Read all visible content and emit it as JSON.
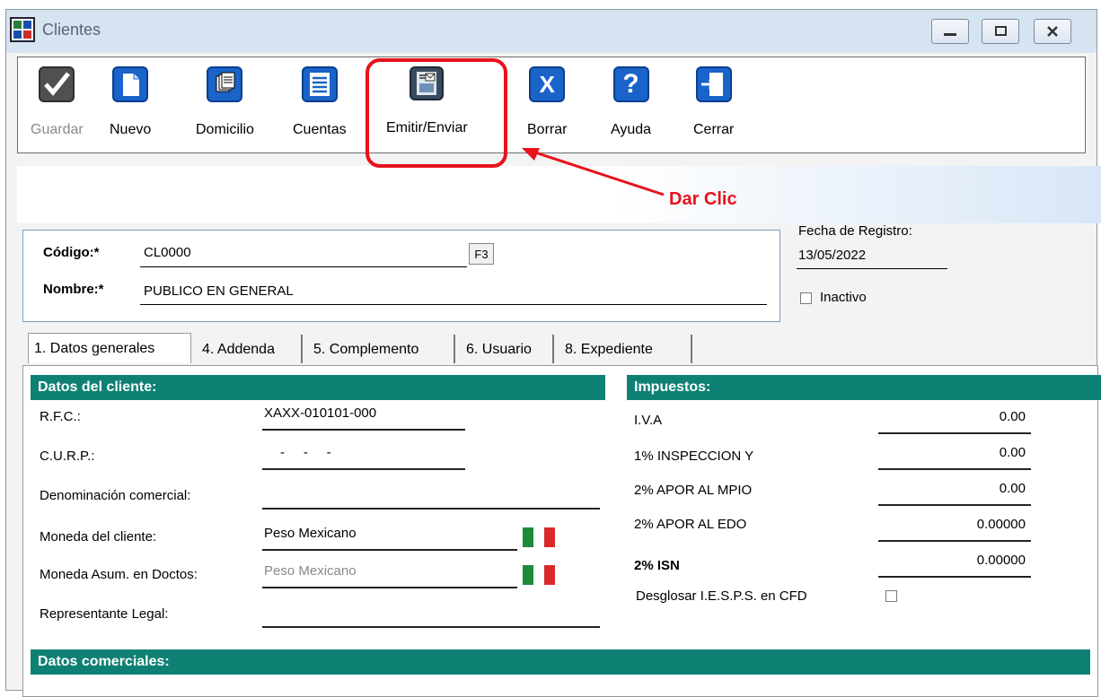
{
  "window": {
    "title": "Clientes"
  },
  "toolbar": {
    "buttons": [
      {
        "id": "guardar",
        "label": "Guardar",
        "enabled": false
      },
      {
        "id": "nuevo",
        "label": "Nuevo",
        "enabled": true
      },
      {
        "id": "domicilio",
        "label": "Domicilio",
        "enabled": true
      },
      {
        "id": "cuentas",
        "label": "Cuentas",
        "enabled": true
      },
      {
        "id": "emitir",
        "label": "Emitir/Enviar",
        "enabled": true
      },
      {
        "id": "borrar",
        "label": "Borrar",
        "enabled": true
      },
      {
        "id": "ayuda",
        "label": "Ayuda",
        "enabled": true
      },
      {
        "id": "cerrar",
        "label": "Cerrar",
        "enabled": true
      }
    ]
  },
  "callout": {
    "text": "Dar Clic",
    "color": "#e8121a"
  },
  "header": {
    "codigo_label": "Código:*",
    "codigo_value": "CL0000",
    "f3_label": "F3",
    "nombre_label": "Nombre:*",
    "nombre_value": "PUBLICO EN GENERAL",
    "fecha_label": "Fecha de Registro:",
    "fecha_value": "13/05/2022",
    "inactivo_label": "Inactivo"
  },
  "tabs": [
    {
      "label": "1. Datos generales",
      "active": true
    },
    {
      "label": "4. Addenda",
      "active": false
    },
    {
      "label": "5. Complemento",
      "active": false
    },
    {
      "label": "6. Usuario",
      "active": false
    },
    {
      "label": "8. Expediente",
      "active": false
    }
  ],
  "datos_cliente": {
    "heading": "Datos del cliente:",
    "rfc_label": "R.F.C.:",
    "rfc_value": "XAXX-010101-000",
    "curp_label": "C.U.R.P.:",
    "curp_value": "-     -     -",
    "denominacion_label": "Denominación comercial:",
    "denominacion_value": "",
    "moneda_label": "Moneda del cliente:",
    "moneda_value": "Peso Mexicano",
    "moneda_asum_label": "Moneda Asum. en Doctos:",
    "moneda_asum_value": "Peso Mexicano",
    "representante_label": "Representante Legal:",
    "representante_value": ""
  },
  "impuestos": {
    "heading": "Impuestos:",
    "rows": [
      {
        "label": "I.V.A",
        "value": "0.00"
      },
      {
        "label": "1% INSPECCION Y",
        "value": "0.00"
      },
      {
        "label": "2% APOR AL MPIO",
        "value": "0.00"
      },
      {
        "label": "2% APOR AL EDO",
        "value": "0.00000"
      },
      {
        "label": "2% ISN",
        "value": "0.00000"
      }
    ],
    "desglosar_label": "Desglosar I.E.S.P.S. en CFD"
  },
  "datos_comerciales": {
    "heading": "Datos comerciales:"
  },
  "colors": {
    "section_header": "#0f8074",
    "toolbar_icon_blue": "#1a63c9",
    "callout_red": "#e8121a"
  }
}
